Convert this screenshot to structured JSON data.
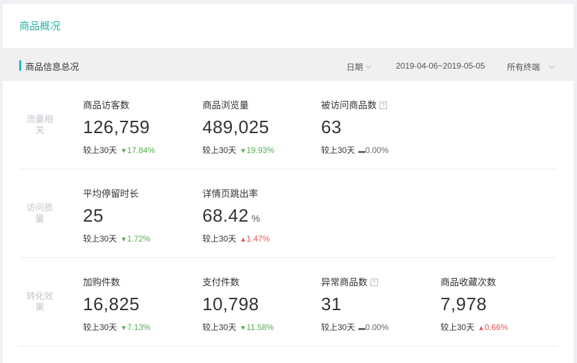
{
  "page_title": "商品概况",
  "section_title": "商品信息总况",
  "filters": {
    "date_label": "日期",
    "date_range": "2019-04-06~2019-05-05",
    "terminal": "所有终端"
  },
  "colors": {
    "accent": "#19b8c4",
    "title": "#2bb0a5",
    "down": "#52b04d",
    "up": "#e65454"
  },
  "groups": [
    {
      "label": "流量相关",
      "metrics": [
        {
          "name": "商品访客数",
          "value": "126,759",
          "compare_label": "较上30天",
          "trend": "down",
          "change": "17.84%"
        },
        {
          "name": "商品浏览量",
          "value": "489,025",
          "compare_label": "较上30天",
          "trend": "down",
          "change": "19.93%"
        },
        {
          "name": "被访问商品数",
          "value": "63",
          "compare_label": "较上30天",
          "trend": "flat",
          "change": "0.00%",
          "help_icon": "question-icon"
        }
      ]
    },
    {
      "label": "访问质量",
      "metrics": [
        {
          "name": "平均停留时长",
          "value": "25",
          "compare_label": "较上30天",
          "trend": "down",
          "change": "1.72%"
        },
        {
          "name": "详情页跳出率",
          "value": "68.42",
          "unit": "%",
          "compare_label": "较上30天",
          "trend": "up",
          "change": "1.47%"
        }
      ]
    },
    {
      "label": "转化效果",
      "metrics": [
        {
          "name": "加购件数",
          "value": "16,825",
          "compare_label": "较上30天",
          "trend": "down",
          "change": "7.13%"
        },
        {
          "name": "支付件数",
          "value": "10,798",
          "compare_label": "较上30天",
          "trend": "down",
          "change": "11.58%"
        },
        {
          "name": "异常商品数",
          "value": "31",
          "compare_label": "较上30天",
          "trend": "flat",
          "change": "0.00%",
          "help_icon": "question-icon"
        },
        {
          "name": "商品收藏次数",
          "value": "7,978",
          "compare_label": "较上30天",
          "trend": "up",
          "change": "0.66%"
        }
      ]
    }
  ]
}
